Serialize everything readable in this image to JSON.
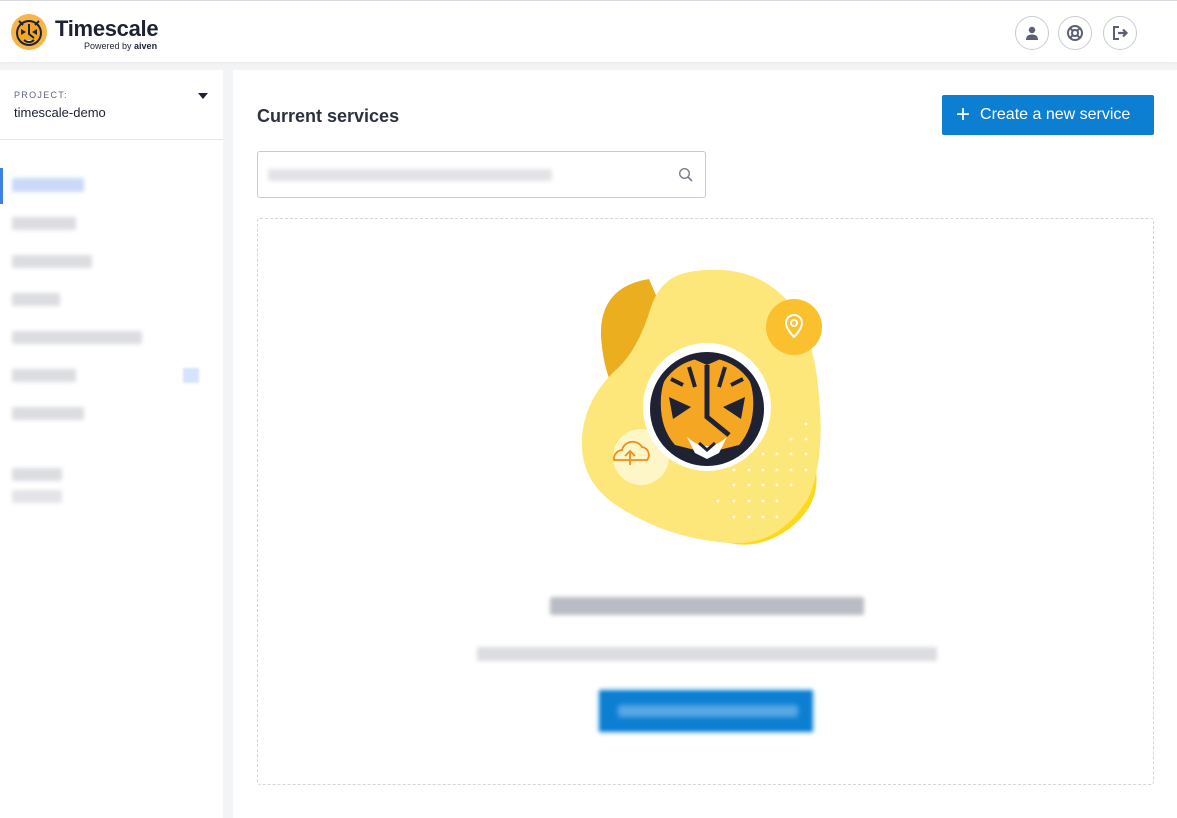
{
  "header": {
    "brand_name": "Timescale",
    "brand_powered_by": "Powered by",
    "brand_partner": "aiven",
    "icons": [
      "user-icon",
      "help-lifebuoy-icon",
      "logout-icon"
    ]
  },
  "sidebar": {
    "project_label": "PROJECT:",
    "project_name": "timescale-demo"
  },
  "main": {
    "title": "Current services",
    "create_button_label": "Create a new service",
    "search_icon": "search-icon"
  },
  "colors": {
    "primary": "#0c7fd3",
    "active_nav": "#3f7fe8",
    "tiger_orange": "#f5a623",
    "blob_yellow": "#fde67a"
  }
}
